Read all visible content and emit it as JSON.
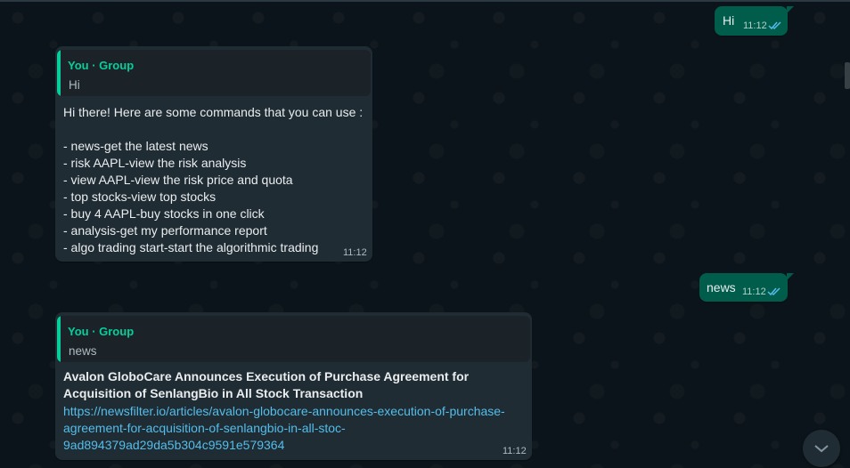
{
  "messages": {
    "out1": {
      "text": "Hi",
      "time": "11:12"
    },
    "in1": {
      "quote_author": "You · Group",
      "quote_text": "Hi",
      "lines": [
        "Hi there! Here are some commands that you can use :",
        "",
        "- news-get the latest news",
        "- risk AAPL-view the risk analysis",
        "- view AAPL-view the risk price and quota",
        "- top stocks-view top stocks",
        "- buy 4 AAPL-buy stocks in one click",
        "- analysis-get my performance report",
        "- algo trading start-start the algorithmic trading"
      ],
      "time": "11:12"
    },
    "out2": {
      "text": "news",
      "time": "11:12"
    },
    "in2": {
      "quote_author": "You · Group",
      "quote_text": "news",
      "title_lines": [
        "Avalon GloboCare Announces Execution of Purchase Agreement for",
        "Acquisition of SenlangBio in All Stock Transaction"
      ],
      "link_lines": [
        "https://newsfilter.io/articles/avalon-globocare-announces-execution-of-purchase-",
        "agreement-for-acquisition-of-senlangbio-in-all-stoc-",
        "9ad894379ad29da5b304c9591e579364"
      ],
      "time": "11:12"
    }
  },
  "icons": {
    "read_receipt": "double-check-icon",
    "scroll_down": "chevron-down-icon"
  },
  "colors": {
    "background": "#0b141a",
    "incoming_bubble": "#202c33",
    "outgoing_bubble": "#005c4b",
    "quote_accent": "#06cf9c",
    "link": "#53bdeb",
    "read_tick": "#53bdeb"
  }
}
